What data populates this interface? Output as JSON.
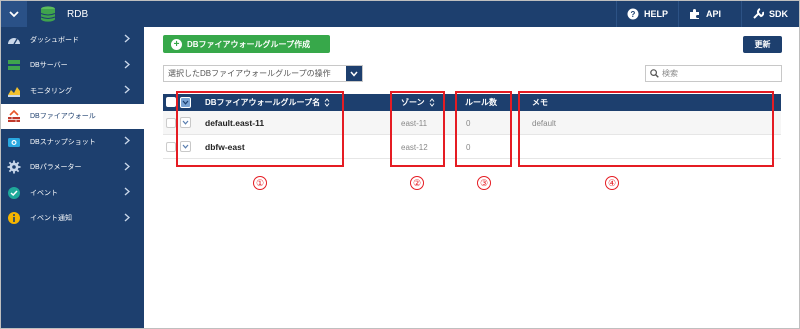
{
  "app": {
    "title": "RDB"
  },
  "topbar": {
    "help_label": "HELP",
    "api_label": "API",
    "sdk_label": "SDK"
  },
  "sidebar": {
    "items": [
      {
        "label": "ダッシュボード",
        "icon": "dashboard-icon"
      },
      {
        "label": "DBサーバー",
        "icon": "db-server-icon"
      },
      {
        "label": "モニタリング",
        "icon": "monitoring-icon"
      },
      {
        "label": "DBファイアウォール",
        "icon": "firewall-icon",
        "active": true
      },
      {
        "label": "DBスナップショット",
        "icon": "camera-icon"
      },
      {
        "label": "DBパラメーター",
        "icon": "gear-icon"
      },
      {
        "label": "イベント",
        "icon": "check-circle-icon"
      },
      {
        "label": "イベント通知",
        "icon": "info-icon"
      }
    ]
  },
  "toolbar": {
    "create_label": "DBファイアウォールグループ作成",
    "refresh_label": "更新",
    "operation_placeholder": "選択したDBファイアウォールグループの操作",
    "search_placeholder": "検索"
  },
  "table": {
    "columns": [
      "DBファイアウォールグループ名",
      "ゾーン",
      "ルール数",
      "メモ"
    ],
    "rows": [
      {
        "name": "default.east-11",
        "zone": "east-11",
        "rules": "0",
        "memo": "default"
      },
      {
        "name": "dbfw-east",
        "zone": "east-12",
        "rules": "0",
        "memo": ""
      }
    ]
  },
  "annotations": {
    "labels": [
      "①",
      "②",
      "③",
      "④"
    ]
  },
  "colors": {
    "navy": "#1d3f6e",
    "green": "#37a84a",
    "annotation_red": "#e51c23"
  }
}
